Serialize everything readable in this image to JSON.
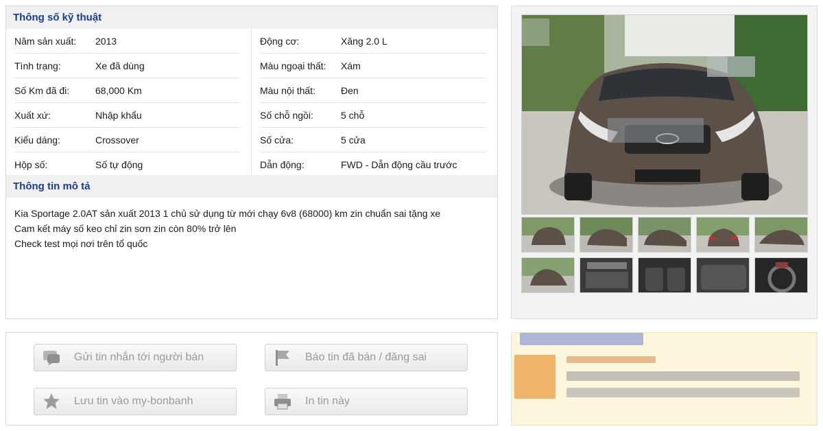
{
  "specs": {
    "title": "Thông số kỹ thuật",
    "left": [
      {
        "label": "Năm sản xuất:",
        "value": "2013"
      },
      {
        "label": "Tình trạng:",
        "value": "Xe đã dùng"
      },
      {
        "label": "Số Km đã đi:",
        "value": "68,000 Km"
      },
      {
        "label": "Xuất xứ:",
        "value": "Nhập khẩu"
      },
      {
        "label": "Kiểu dáng:",
        "value": "Crossover"
      },
      {
        "label": "Hộp số:",
        "value": "Số tự động"
      }
    ],
    "right": [
      {
        "label": "Động cơ:",
        "value": "Xăng 2.0 L"
      },
      {
        "label": "Màu ngoại thất:",
        "value": "Xám"
      },
      {
        "label": "Màu nội thất:",
        "value": "Đen"
      },
      {
        "label": "Số chỗ ngồi:",
        "value": "5 chỗ"
      },
      {
        "label": "Số cửa:",
        "value": "5 cửa"
      },
      {
        "label": "Dẫn động:",
        "value": "FWD - Dẫn động cầu trước"
      }
    ]
  },
  "description": {
    "title": "Thông tin mô tả",
    "lines": [
      "Kia Sportage 2.0AT sản xuất 2013 1 chủ sử dụng từ mới chạy 6v8 (68000) km zin chuẩn sai tặng xe",
      "Cam kết máy số keo chỉ zin sơn zin còn 80% trở lên",
      "Check test mọi nơi trên tổ quốc"
    ]
  },
  "actions": {
    "send_message": "Gửi tin nhắn tới người bán",
    "report": "Báo tin đã bán / đăng sai",
    "save": "Lưu tin vào my-bonbanh",
    "print": "In tin này"
  },
  "gallery": {
    "thumb_count": 10
  },
  "colors": {
    "header_text": "#1a3d8f",
    "header_bg": "#f0f0f0",
    "button_text": "#9a9a9a",
    "ad_bg": "#fbf6dc"
  },
  "icons": {
    "send_message": "chat-bubble-icon",
    "report": "flag-icon",
    "save": "star-icon",
    "print": "printer-icon"
  }
}
